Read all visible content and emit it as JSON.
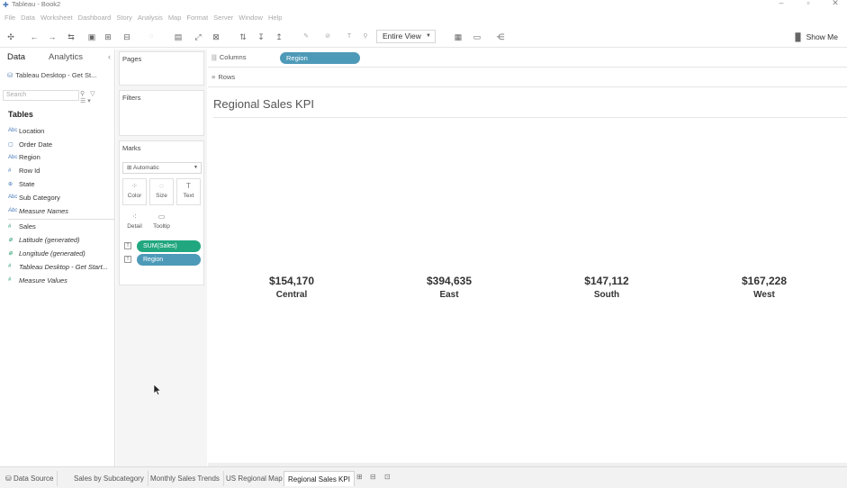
{
  "window": {
    "title": "Tableau - Book2"
  },
  "menu": [
    "File",
    "Data",
    "Worksheet",
    "Dashboard",
    "Story",
    "Analysis",
    "Map",
    "Format",
    "Server",
    "Window",
    "Help"
  ],
  "toolbar": {
    "fit": "Entire View",
    "show_me": "Show Me"
  },
  "datapane": {
    "tab_data": "Data",
    "tab_analytics": "Analytics",
    "datasource": "Tableau Desktop - Get St...",
    "search_placeholder": "Search",
    "tables_header": "Tables",
    "dimensions": [
      {
        "label": "Location",
        "icon": "Abc"
      },
      {
        "label": "Order Date",
        "icon": "▢"
      },
      {
        "label": "Region",
        "icon": "Abc"
      },
      {
        "label": "Row Id",
        "icon": "#"
      },
      {
        "label": "State",
        "icon": "⊕"
      },
      {
        "label": "Sub Category",
        "icon": "Abc"
      },
      {
        "label": "Measure Names",
        "icon": "Abc"
      }
    ],
    "measures": [
      {
        "label": "Sales",
        "icon": "#"
      },
      {
        "label": "Latitude (generated)",
        "icon": "⊕"
      },
      {
        "label": "Longitude (generated)",
        "icon": "⊕"
      },
      {
        "label": "Tableau Desktop - Get Start...",
        "icon": "#"
      },
      {
        "label": "Measure Values",
        "icon": "#"
      }
    ]
  },
  "cards": {
    "pages": "Pages",
    "filters": "Filters",
    "marks": "Marks",
    "mark_type": "Automatic",
    "mark_buttons": [
      "Color",
      "Size",
      "Text",
      "Detail",
      "Tooltip"
    ],
    "mark_pills": [
      "SUM(Sales)",
      "Region"
    ]
  },
  "shelves": {
    "columns_label": "Columns",
    "columns_pill": "Region",
    "rows_label": "Rows"
  },
  "view": {
    "title": "Regional Sales KPI",
    "kpis": [
      {
        "value": "$154,170",
        "region": "Central"
      },
      {
        "value": "$394,635",
        "region": "East"
      },
      {
        "value": "$147,112",
        "region": "South"
      },
      {
        "value": "$167,228",
        "region": "West"
      }
    ]
  },
  "sheet_tabs": {
    "data_source": "Data Source",
    "tabs": [
      "Sales by Subcategory",
      "Monthly Sales Trends",
      "US Regional Map",
      "Regional Sales KPI"
    ],
    "active": "Regional Sales KPI"
  },
  "colors": {
    "dimension_pill": "#4d9ab8",
    "measure_pill": "#21a77f"
  }
}
